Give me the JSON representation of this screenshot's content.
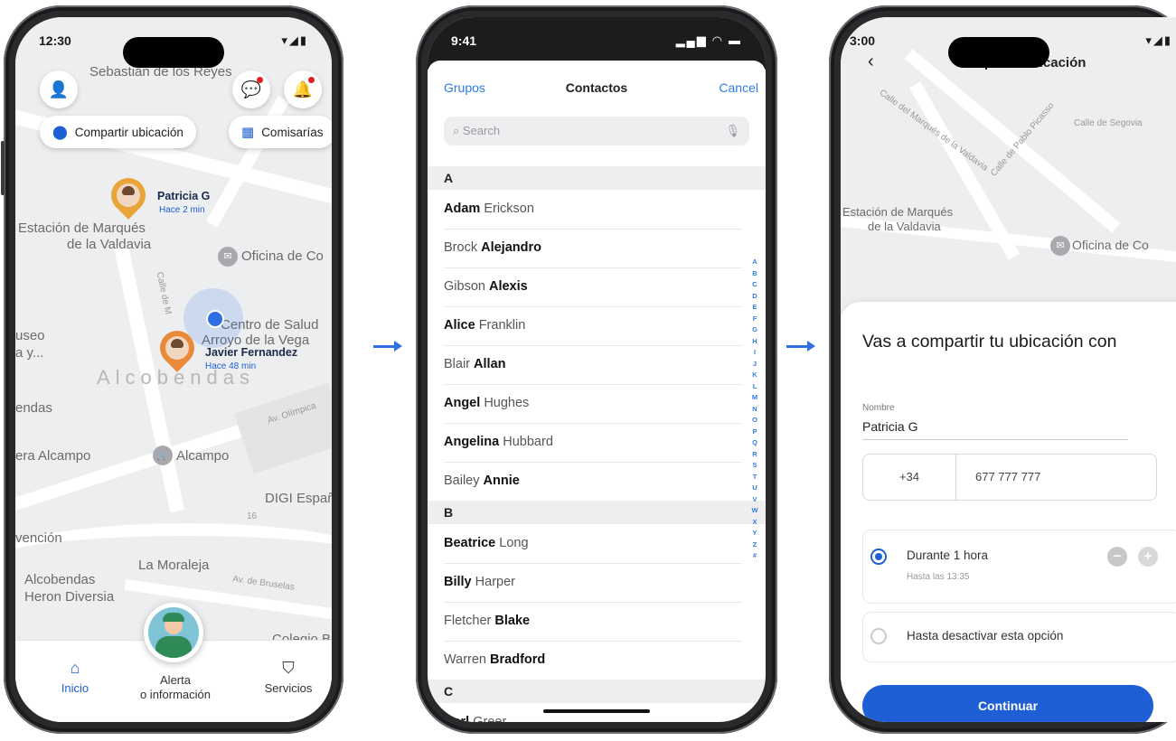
{
  "screen1": {
    "status": {
      "time": "12:30",
      "icons": "▾◢▮"
    },
    "map_labels": {
      "sebastian": "Sebastián de los Reyes",
      "estacion": "Estación de Marqués",
      "valdavia": "de la Valdavia",
      "oficina": "Oficina de Co",
      "centro1": "Centro de Salud",
      "centro2": "Arroyo de la Vega",
      "museo": "useo",
      "museo2": "a y...",
      "alcobendas_big": "Alcobendas",
      "endas": "endas",
      "hiper": "era Alcampo",
      "alcampo": "Alcampo",
      "digi": "DIGI Españ",
      "vencion": "vención",
      "moraleja": "La Moraleja",
      "alco2": "Alcobendas",
      "heron": "Heron Diversia",
      "colegio": "Colegio Bra",
      "av_olimpica": "Av. Olímpica",
      "av_bruselas": "Av. de Bruselas",
      "calle_marq": "Calle de M",
      "num16": "16"
    },
    "chips": {
      "share": "Compartir ubicación",
      "stations": "Comisarías"
    },
    "contacts": [
      {
        "name": "Patricia G",
        "time": "Hace 2 min"
      },
      {
        "name": "Javier Fernandez",
        "time": "Hace 48 min"
      }
    ],
    "tabs": {
      "home": "Inicio",
      "alert1": "Alerta",
      "alert2": "o información",
      "services": "Servicios"
    }
  },
  "screen2": {
    "status": {
      "time": "9:41",
      "icons": "▂▄▆ ◠ ▬"
    },
    "nav": {
      "left": "Grupos",
      "title": "Contactos",
      "right": "Cancel"
    },
    "search_placeholder": "Search",
    "sections": [
      {
        "letter": "A",
        "contacts": [
          {
            "first": "Adam",
            "last": "Erickson",
            "bold": "first"
          },
          {
            "first": "Brock",
            "last": "Alejandro",
            "bold": "last"
          },
          {
            "first": "Gibson",
            "last": "Alexis",
            "bold": "last"
          },
          {
            "first": "Alice",
            "last": "Franklin",
            "bold": "first"
          },
          {
            "first": "Blair",
            "last": "Allan",
            "bold": "last"
          },
          {
            "first": "Angel",
            "last": "Hughes",
            "bold": "first"
          },
          {
            "first": "Angelina",
            "last": "Hubbard",
            "bold": "first"
          },
          {
            "first": "Bailey",
            "last": "Annie",
            "bold": "last"
          }
        ]
      },
      {
        "letter": "B",
        "contacts": [
          {
            "first": "Beatrice",
            "last": "Long",
            "bold": "first"
          },
          {
            "first": "Billy",
            "last": "Harper",
            "bold": "first"
          },
          {
            "first": "Fletcher",
            "last": "Blake",
            "bold": "last"
          },
          {
            "first": "Warren",
            "last": "Bradford",
            "bold": "last"
          }
        ]
      },
      {
        "letter": "C",
        "contacts": [
          {
            "first": "Carl",
            "last": "Greer",
            "bold": "first"
          }
        ]
      }
    ],
    "index_letters": [
      "A",
      "B",
      "C",
      "D",
      "E",
      "F",
      "G",
      "H",
      "I",
      "J",
      "K",
      "L",
      "M",
      "N",
      "O",
      "P",
      "Q",
      "R",
      "S",
      "T",
      "U",
      "V",
      "W",
      "X",
      "Y",
      "Z",
      "#"
    ]
  },
  "screen3": {
    "status": {
      "time": "3:00",
      "icons": "▾◢▮"
    },
    "header": {
      "back": "‹",
      "title": "Compartir ubicación"
    },
    "map_labels": {
      "estacion": "Estación de Marqués",
      "valdavia": "de la Valdavia",
      "oficina": "Oficina de Co",
      "calle1": "Calle del Marqués de la Valdavia",
      "calle2": "Calle de Pablo Picasso",
      "calle3": "Calle de Segovia"
    },
    "heading": "Vas a compartir tu ubicación con",
    "name_label": "Nombre",
    "name_value": "Patricia G",
    "country_code": "+34",
    "phone_number": "677 777 777",
    "option1": {
      "label": "Durante 1 hora",
      "sub": "Hasta las 13:35",
      "selected": true
    },
    "option2": {
      "label": "Hasta desactivar esta opción",
      "selected": false
    },
    "continue_label": "Continuar"
  }
}
